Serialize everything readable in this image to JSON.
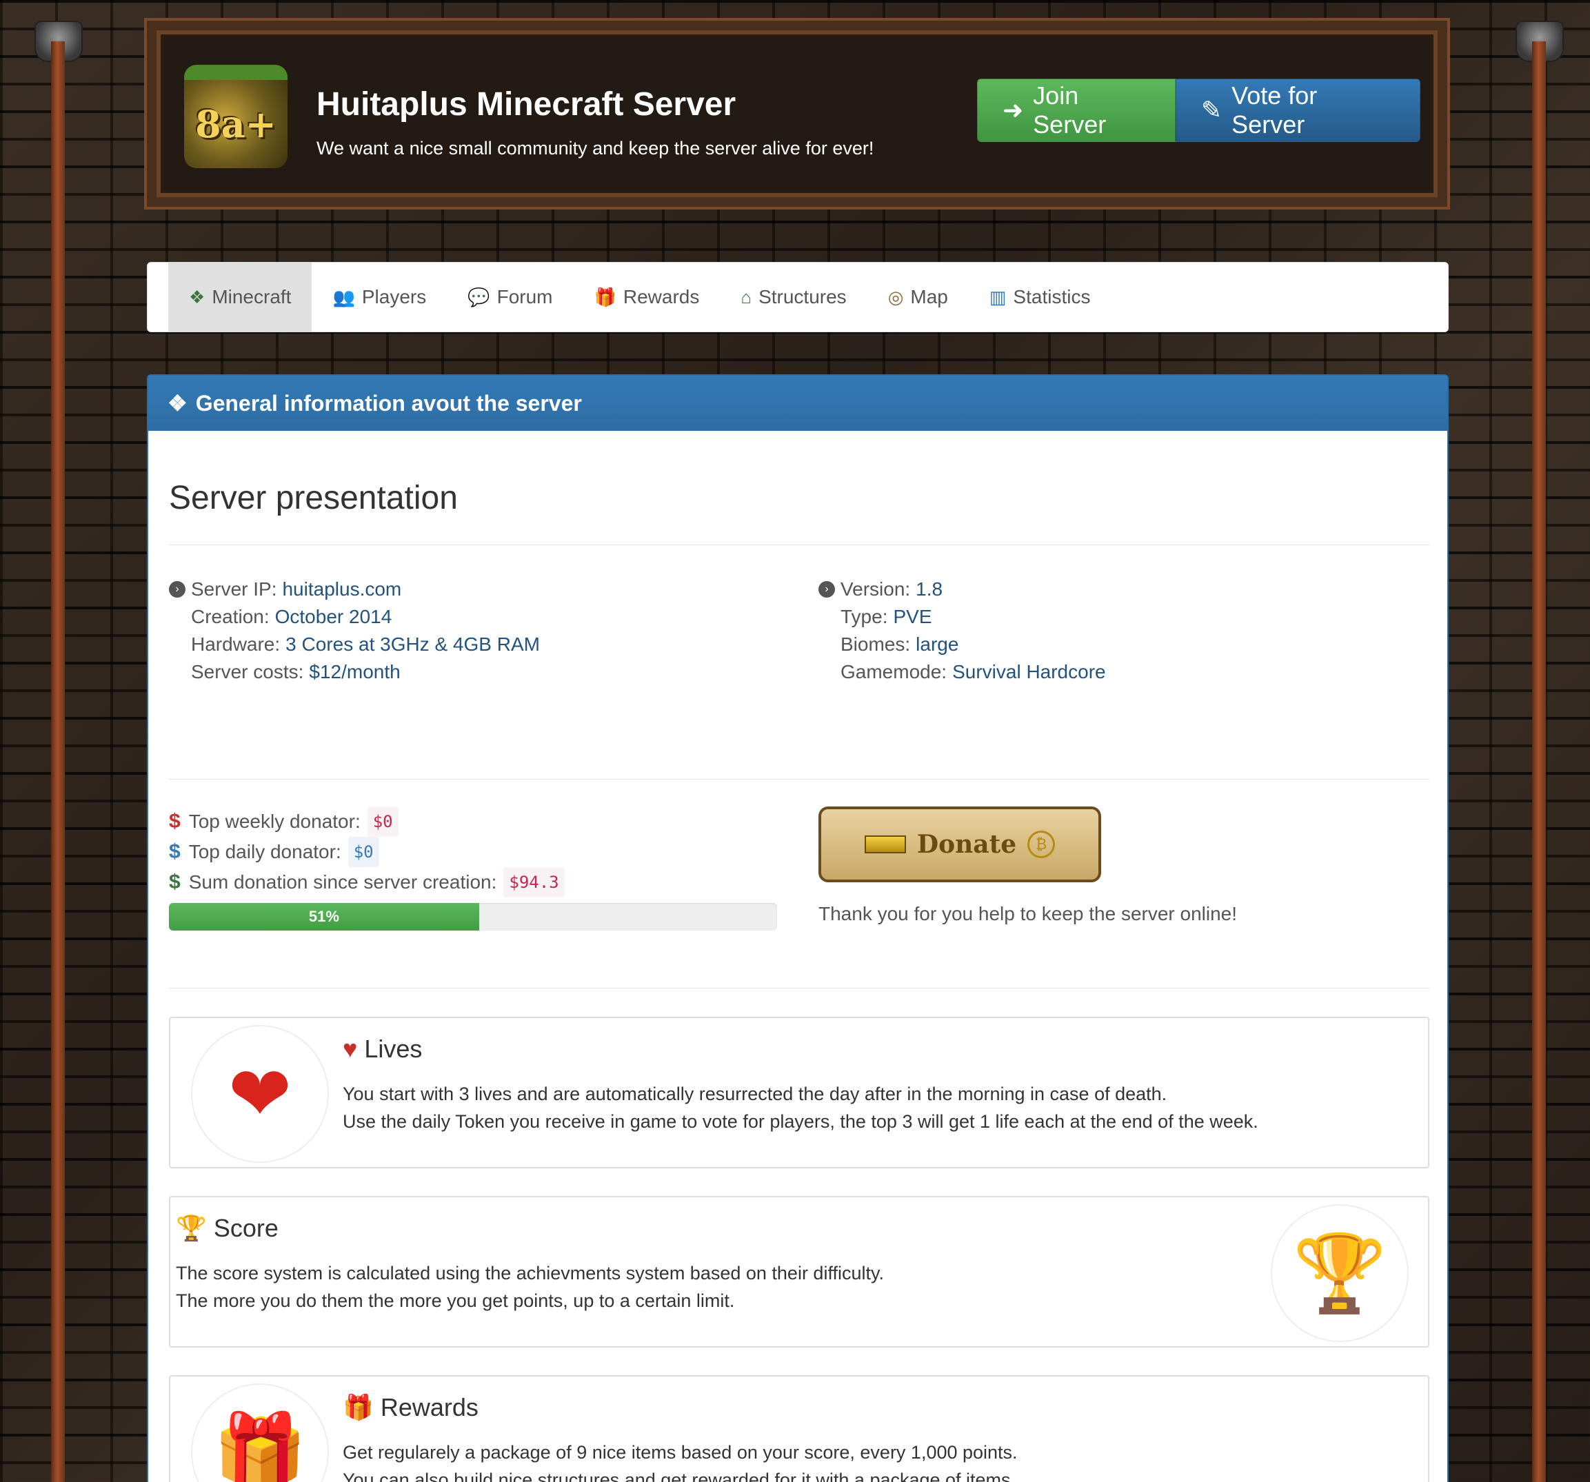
{
  "header": {
    "logo_text": "8a+",
    "title": "Huitaplus Minecraft Server",
    "tagline": "We want a nice small community and keep the server alive for ever!",
    "join_label": "Join Server",
    "vote_label": "Vote for Server"
  },
  "nav": {
    "items": [
      {
        "label": "Minecraft",
        "icon": "cubes-icon",
        "active": true
      },
      {
        "label": "Players",
        "icon": "users-icon"
      },
      {
        "label": "Forum",
        "icon": "comments-icon"
      },
      {
        "label": "Rewards",
        "icon": "gift-icon"
      },
      {
        "label": "Structures",
        "icon": "home-icon"
      },
      {
        "label": "Map",
        "icon": "compass-icon"
      },
      {
        "label": "Statistics",
        "icon": "bar-chart-icon"
      }
    ]
  },
  "panel": {
    "heading": "General information avout the server",
    "section_title": "Server presentation"
  },
  "info_left": [
    {
      "label": "Server IP:",
      "value": "huitaplus.com"
    },
    {
      "label": "Creation:",
      "value": "October 2014"
    },
    {
      "label": "Hardware:",
      "value": "3 Cores at 3GHz & 4GB RAM"
    },
    {
      "label": "Server costs:",
      "value": "$12/month"
    }
  ],
  "info_right": [
    {
      "label": "Version:",
      "value": "1.8"
    },
    {
      "label": "Type:",
      "value": "PVE"
    },
    {
      "label": "Biomes:",
      "value": "large"
    },
    {
      "label": "Gamemode:",
      "value": "Survival Hardcore"
    }
  ],
  "donations": {
    "weekly_label": "Top weekly donator:",
    "weekly_value": "$0",
    "daily_label": "Top daily donator:",
    "daily_value": "$0",
    "sum_label": "Sum donation since server creation:",
    "sum_value": "$94.3",
    "progress_label": "51%",
    "progress_fraction": 0.51,
    "donate_label": "Donate",
    "thanks": "Thank you for you help to keep the server online!"
  },
  "features": {
    "lives": {
      "title": "Lives",
      "line1": "You start with 3 lives and are automatically resurrected the day after in the morning in case of death.",
      "line2": "Use the daily Token you receive in game to vote for players, the top 3 will get 1 life each at the end of the week."
    },
    "score": {
      "title": "Score",
      "line1": "The score system is calculated using the achievments system based on their difficulty.",
      "line2": "The more you do them the more you get points, up to a certain limit."
    },
    "rewards": {
      "title": "Rewards",
      "line1": "Get regularely a package of 9 nice items based on your score, every 1,000 points.",
      "line2": "You can also build nice structures and get rewarded for it with a package of items."
    }
  },
  "colors": {
    "primary": "#337ab7",
    "success": "#5cb85c",
    "danger": "#c9302c",
    "link": "#23527c"
  }
}
